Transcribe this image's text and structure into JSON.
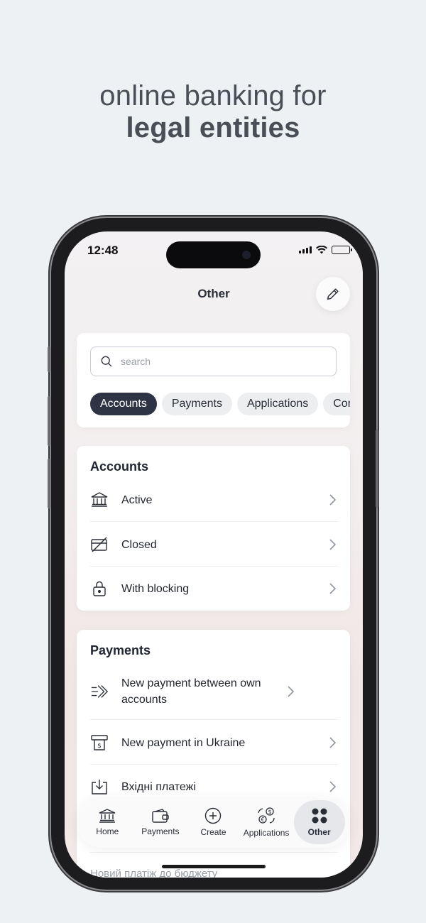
{
  "headline": {
    "line1": "online banking for",
    "line2": "legal entities"
  },
  "status": {
    "time": "12:48"
  },
  "screen": {
    "title": "Other"
  },
  "search": {
    "placeholder": "search"
  },
  "chips": [
    "Accounts",
    "Payments",
    "Applications",
    "Cor"
  ],
  "accounts": {
    "title": "Accounts",
    "items": [
      {
        "label": "Active",
        "icon": "bank-icon"
      },
      {
        "label": "Closed",
        "icon": "card-closed-icon"
      },
      {
        "label": "With blocking",
        "icon": "lock-icon"
      }
    ]
  },
  "payments": {
    "title": "Payments",
    "items": [
      {
        "label": "New payment between own accounts",
        "icon": "transfer-icon"
      },
      {
        "label": "New payment in Ukraine",
        "icon": "payment-order-icon"
      },
      {
        "label": "Вхідні платежі",
        "icon": "incoming-icon"
      }
    ],
    "peek_label": "Новий платіж до бюджету"
  },
  "tabbar": [
    {
      "label": "Home",
      "icon": "bank-icon"
    },
    {
      "label": "Payments",
      "icon": "wallet-icon"
    },
    {
      "label": "Create",
      "icon": "plus-circle-icon"
    },
    {
      "label": "Applications",
      "icon": "currency-exchange-icon"
    },
    {
      "label": "Other",
      "icon": "grid-icon"
    }
  ],
  "colors": {
    "accent": "#2e3444",
    "background": "#eef1f4"
  }
}
